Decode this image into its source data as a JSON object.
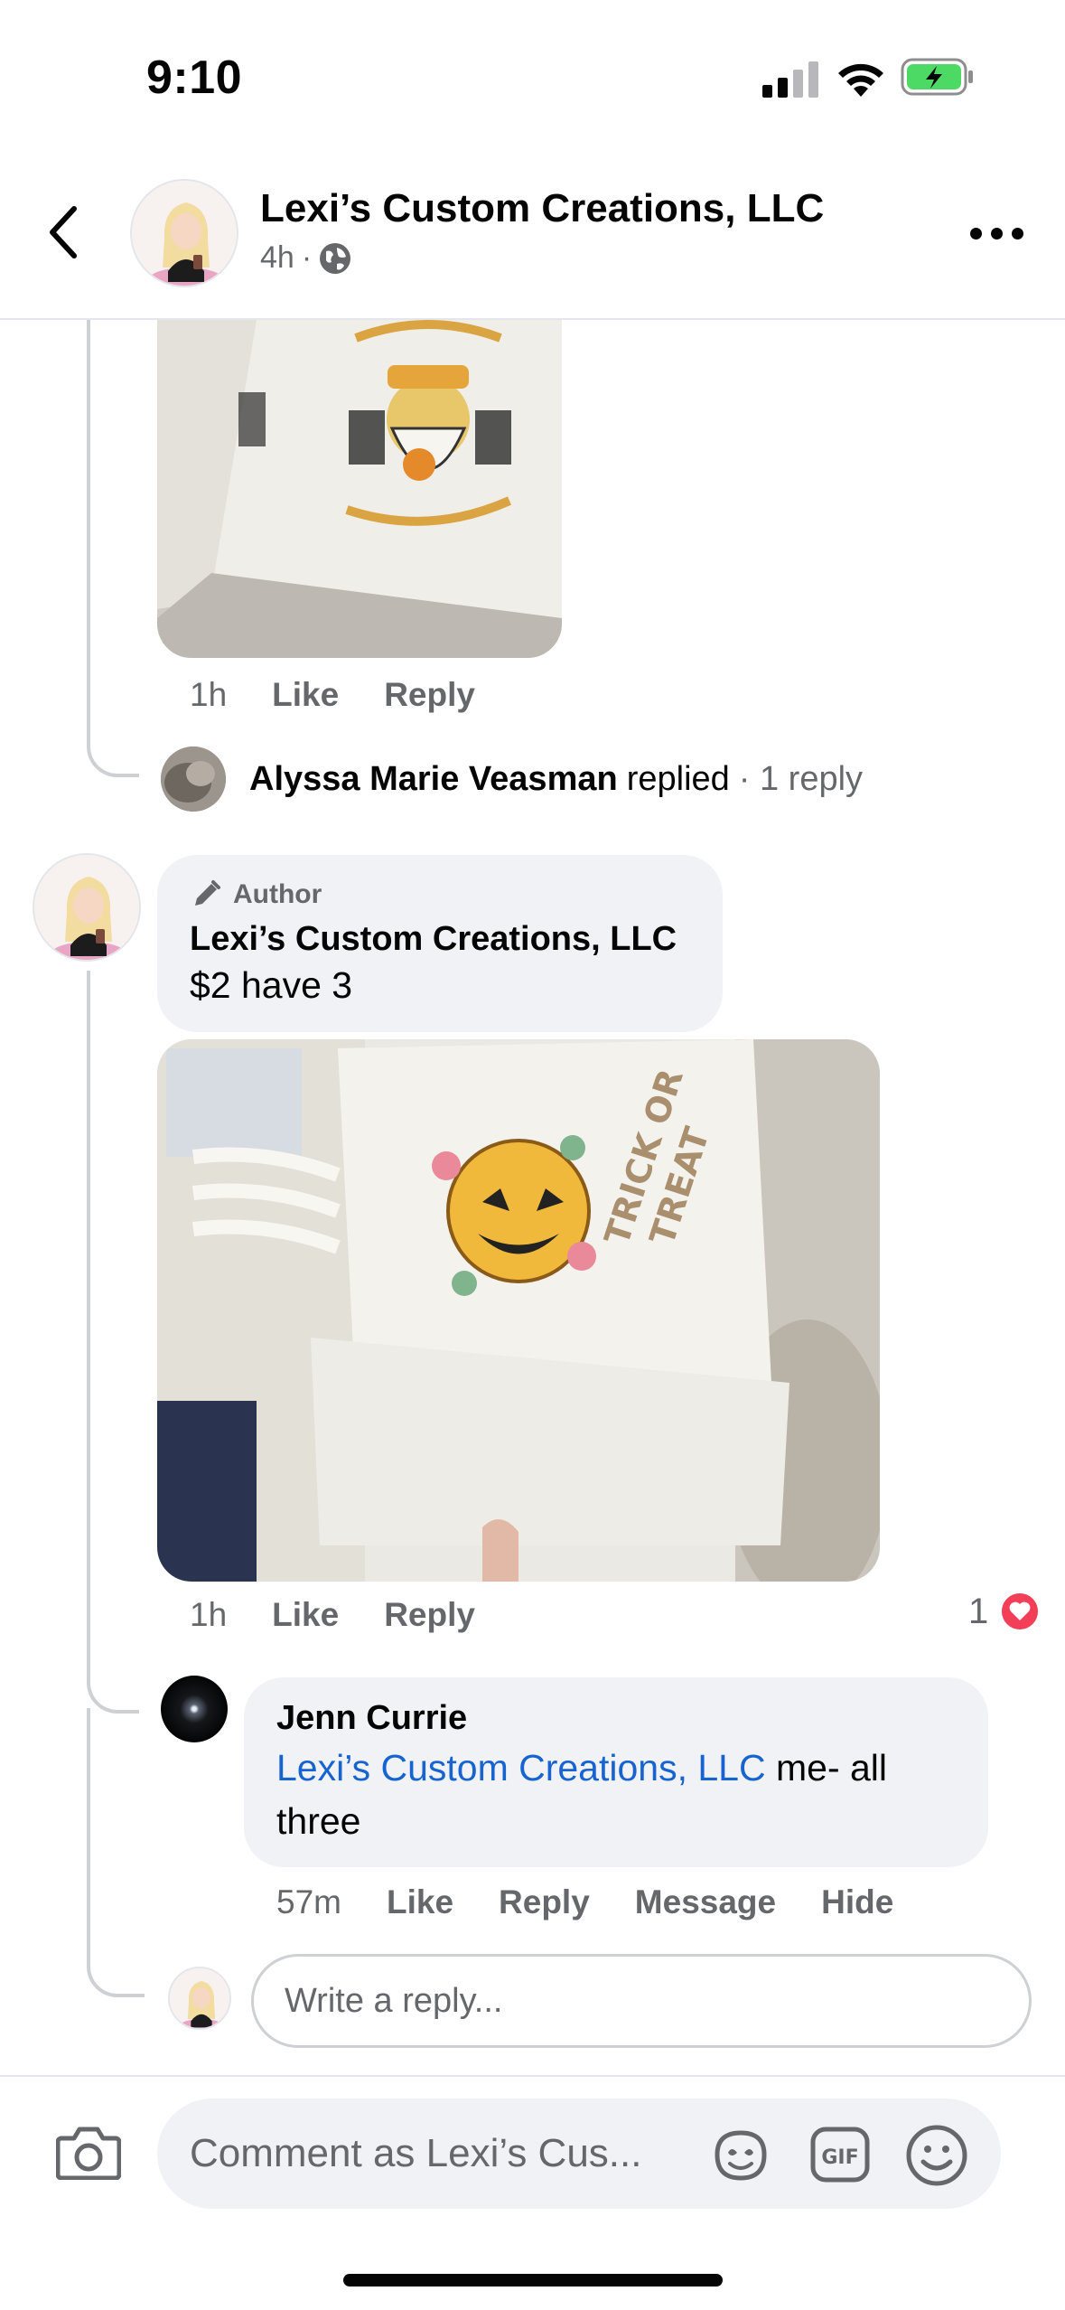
{
  "status_bar": {
    "time": "9:10"
  },
  "header": {
    "title": "Lexi’s Custom Creations, LLC",
    "meta_time": "4h",
    "meta_separator": "·"
  },
  "first_comment": {
    "time": "1h",
    "like_label": "Like",
    "reply_label": "Reply"
  },
  "reply_summary": {
    "name": "Alyssa Marie Veasman",
    "action": "replied",
    "count": "· 1 reply"
  },
  "author_comment": {
    "badge": "Author",
    "name": "Lexi’s Custom Creations, LLC",
    "text": "$2 have 3",
    "time": "1h",
    "like_label": "Like",
    "reply_label": "Reply",
    "reaction_count": "1"
  },
  "jenn_reply": {
    "name": "Jenn Currie",
    "mention": "Lexi’s Custom Creations, LLC",
    "text": " me- all three",
    "time": "57m",
    "like_label": "Like",
    "reply_label": "Reply",
    "message_label": "Message",
    "hide_label": "Hide"
  },
  "write_reply": {
    "placeholder": "Write a reply..."
  },
  "composer": {
    "placeholder": "Comment as Lexi’s Cus..."
  },
  "icons": {
    "back": "chevron-left-icon",
    "globe": "globe-icon",
    "more": "more-horizontal-icon",
    "camera": "camera-icon",
    "sticker": "sticker-icon",
    "gif": "gif-icon",
    "emoji": "emoji-icon",
    "author": "pencil-icon",
    "heart": "heart-icon"
  },
  "colors": {
    "mention": "#1763cf",
    "heart": "#f33e58",
    "battery": "#4cd964",
    "secondary_text": "#65676b",
    "bubble": "#f0f2f5"
  }
}
